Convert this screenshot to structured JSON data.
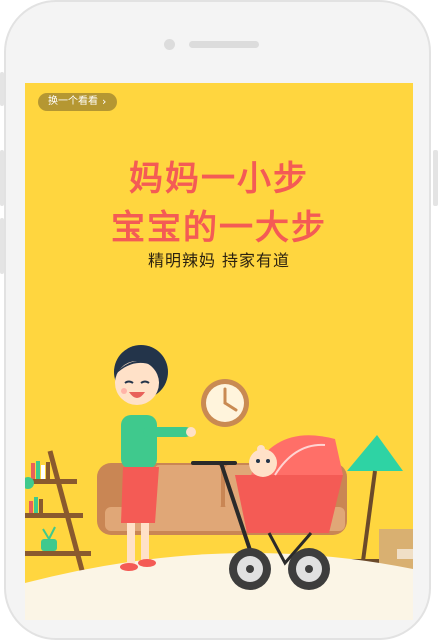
{
  "app": {
    "switch_label": "换一个看看",
    "chevron_icon": "chevron-right-icon"
  },
  "hero": {
    "title_line1": "妈妈一小步",
    "title_line2": "宝宝的一大步",
    "subtitle": "精明辣妈 持家有道"
  },
  "colors": {
    "background": "#ffd63f",
    "title": "#f45b55",
    "stroller": "#f45b55",
    "lamp": "#2ed3a4",
    "mom_shirt": "#3fc98d",
    "mom_skirt": "#f45b55",
    "sofa": "#d89b5e"
  }
}
